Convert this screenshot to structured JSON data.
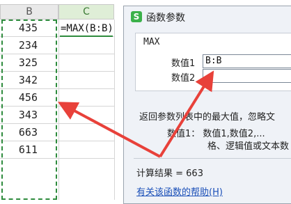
{
  "sheet": {
    "columns": [
      "B",
      "C"
    ],
    "values": [
      "435",
      "234",
      "325",
      "342",
      "456",
      "343",
      "663",
      "611"
    ],
    "formula": "=MAX(B:B)"
  },
  "dialog": {
    "title": "函数参数",
    "function_name": "MAX",
    "arg1_label": "数值1",
    "arg1_value": "B:B",
    "arg2_label": "数值2",
    "arg2_value": "",
    "description": "返回参数列表中的最大值，忽略文",
    "arg_desc_line1": "数值1： 数值1,数值2,...",
    "arg_desc_line2": "格、逻辑值或文本数",
    "result": "计算结果 = 663",
    "help_link": "有关该函数的帮助(H)"
  },
  "colors": {
    "accent_green": "#2e8b3d",
    "arrow_red": "#e8413a",
    "link_blue": "#1a4fb8"
  }
}
